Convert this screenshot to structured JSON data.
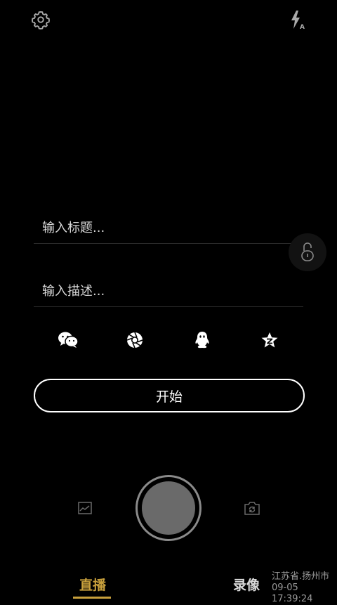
{
  "inputs": {
    "title_placeholder": "输入标题...",
    "description_placeholder": "输入描述..."
  },
  "start_button_label": "开始",
  "tabs": {
    "live": "直播",
    "record": "录像"
  },
  "watermark": {
    "location": "江苏省.扬州市",
    "datetime": "09-05 17:39:24"
  },
  "icons": {
    "settings": "gear-icon",
    "flash": "flash-auto-icon",
    "lock": "unlock-icon",
    "share": [
      "wechat-icon",
      "moments-icon",
      "qq-icon",
      "qzone-icon"
    ],
    "gallery": "gallery-icon",
    "switch_camera": "switch-camera-icon"
  },
  "colors": {
    "accent": "#c8a03c",
    "background": "#000000"
  }
}
